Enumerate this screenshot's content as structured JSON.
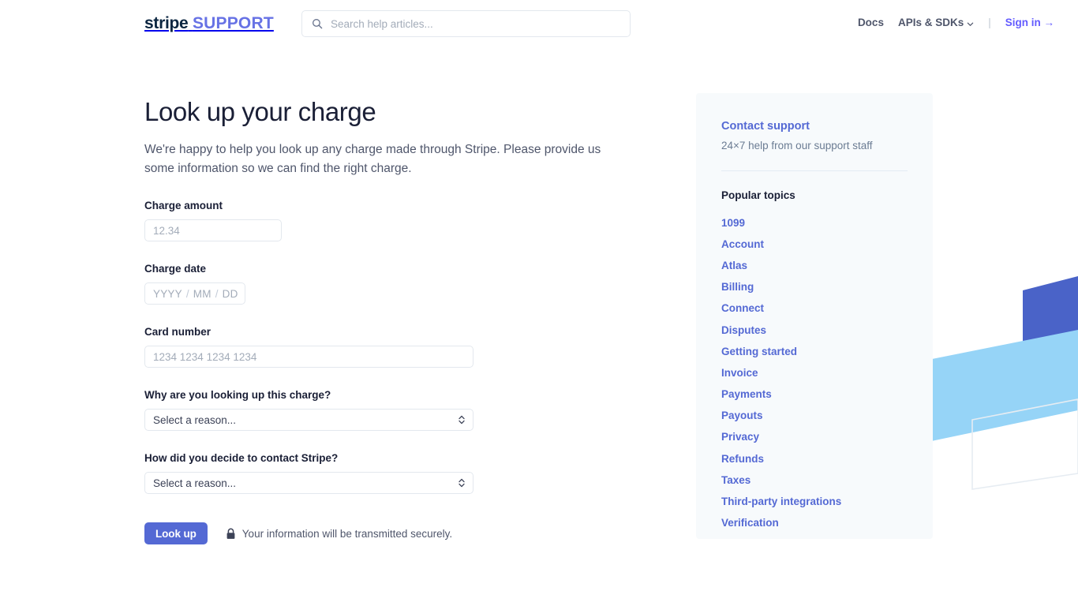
{
  "header": {
    "logo": {
      "primary": "stripe",
      "secondary": "SUPPORT"
    },
    "search": {
      "placeholder": "Search help articles...",
      "value": "",
      "icon": "search-icon"
    },
    "nav": {
      "docs": "Docs",
      "apis": "APIs & SDKs",
      "separator": "|",
      "signin": "Sign in →"
    }
  },
  "main": {
    "title": "Look up your charge",
    "intro": "We're happy to help you look up any charge made through Stripe. Please provide us some information so we can find the right charge.",
    "fields": {
      "charge_amount": {
        "label": "Charge amount",
        "placeholder": "12.34",
        "value": ""
      },
      "charge_date": {
        "label": "Charge date",
        "year_placeholder": "YYYY",
        "month_placeholder": "MM",
        "day_placeholder": "DD",
        "separator": "/"
      },
      "card_number": {
        "label": "Card number",
        "placeholder": "1234 1234 1234 1234",
        "value": ""
      },
      "reason": {
        "label": "Why are you looking up this charge?",
        "selected": "Select a reason...",
        "options": [
          "Select a reason..."
        ]
      },
      "contact_method": {
        "label": "How did you decide to contact Stripe?",
        "selected": "Select a reason...",
        "options": [
          "Select a reason..."
        ]
      }
    },
    "submit": {
      "label": "Look up"
    },
    "secure_notice": {
      "text": "Your information will be transmitted securely.",
      "icon": "lock-icon"
    }
  },
  "sidebar": {
    "contact": {
      "link": "Contact support",
      "subtitle": "24×7 help from our support staff"
    },
    "topics_title": "Popular topics",
    "topics": [
      "1099",
      "Account",
      "Atlas",
      "Billing",
      "Connect",
      "Disputes",
      "Getting started",
      "Invoice",
      "Payments",
      "Payouts",
      "Privacy",
      "Refunds",
      "Taxes",
      "Third-party integrations",
      "Verification"
    ]
  },
  "colors": {
    "brand_indigo": "#5469d4",
    "link_indigo": "#635bff",
    "logo_support": "#6772e5",
    "sidebar_bg": "#f7fafc",
    "text_dark": "#1a1f36",
    "text_muted": "#4f566b",
    "placeholder": "#a3acb9",
    "decor_dark_blue": "#4a63c8",
    "decor_light_blue": "#96d4f7"
  }
}
